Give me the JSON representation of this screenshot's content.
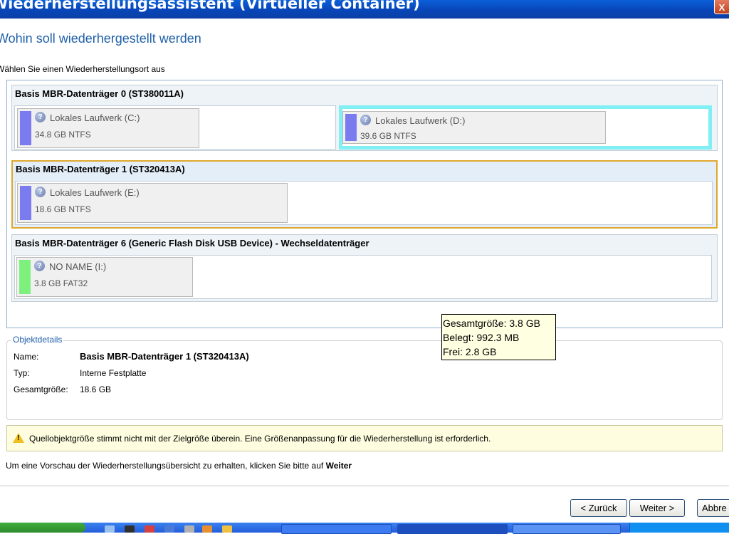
{
  "window": {
    "title": "Wiederherstellungsassistent (Virtueller Container)",
    "close_label": "X"
  },
  "page": {
    "heading": "Wohin soll wiederhergestellt werden",
    "instruction": "Wählen Sie einen Wiederherstellungsort aus"
  },
  "disks": [
    {
      "title": "Basis MBR-Datenträger 0 (ST380011A)",
      "partitions": [
        {
          "name": "Lokales Laufwerk (C:)",
          "detail": "34.8 GB NTFS",
          "color": "#7b7bf0"
        },
        {
          "name": "Lokales Laufwerk (D:)",
          "detail": "39.6 GB NTFS",
          "color": "#7b7bf0"
        }
      ]
    },
    {
      "title": "Basis MBR-Datenträger 1 (ST320413A)",
      "partitions": [
        {
          "name": "Lokales Laufwerk (E:)",
          "detail": "18.6 GB NTFS",
          "color": "#7b7bf0"
        }
      ]
    },
    {
      "title": "Basis MBR-Datenträger 6 (Generic Flash Disk USB Device) - Wechseldatenträger",
      "partitions": [
        {
          "name": "NO NAME (I:)",
          "detail": "3.8 GB FAT32",
          "color": "#7ef07e"
        }
      ]
    }
  ],
  "tooltip": {
    "total": "Gesamtgröße:  3.8 GB",
    "used": "Belegt:  992.3 MB",
    "free": "Frei:  2.8 GB"
  },
  "details": {
    "legend": "Objektdetails",
    "name_label": "Name:",
    "name_value": "Basis MBR-Datenträger 1 (ST320413A)",
    "type_label": "Typ:",
    "type_value": "Interne Festplatte",
    "size_label": "Gesamtgröße:",
    "size_value": "18.6 GB"
  },
  "warning": "Quellobjektgröße stimmt nicht mit der Zielgröße überein. Eine Größenanpassung für die Wiederherstellung ist erforderlich.",
  "hint": {
    "text": "Um eine Vorschau der Wiederherstellungsübersicht zu erhalten, klicken Sie bitte auf ",
    "bold": "Weiter"
  },
  "buttons": {
    "back": "< Zurück",
    "next": "Weiter >",
    "cancel": "Abbre"
  },
  "colors": {
    "accent": "#1f5fa8",
    "selection": "#e0a82c",
    "highlight": "#80f0f4"
  }
}
